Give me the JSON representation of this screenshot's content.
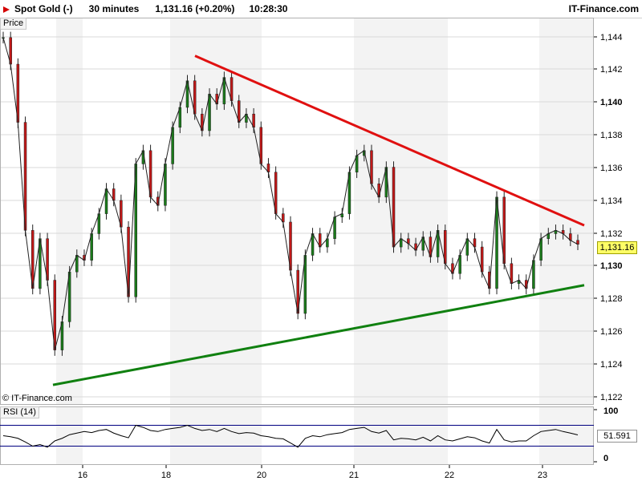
{
  "header": {
    "instrument": "Spot Gold (-)",
    "timeframe": "30 minutes",
    "quote": "1,131.16 (+0.20%)",
    "time": "10:28:30",
    "brand": "IT-Finance.com",
    "arrow_color": "#d40000"
  },
  "price_panel": {
    "tag": "Price",
    "copyright": "© IT-Finance.com",
    "last_price_label": "1,131.16"
  },
  "rsi_panel": {
    "tag": "RSI (14)",
    "value_label": "51.591",
    "upper_label": "100",
    "lower_label": "0"
  },
  "colors": {
    "resistance": "#e01010",
    "support": "#108010",
    "candle": "#222222",
    "up_body": "#1a7a1a",
    "down_body": "#c01818",
    "shade": "#f3f3f3"
  },
  "chart_data": [
    {
      "type": "line",
      "title": "Spot Gold (-) 30 minutes",
      "xlabel": "",
      "ylabel": "Price",
      "x_ticks": [
        "16",
        "18",
        "20",
        "21",
        "22",
        "23"
      ],
      "y_ticks": [
        "1,122",
        "1,124",
        "1,126",
        "1,128",
        "1,130",
        "1,132",
        "1,134",
        "1,136",
        "1,138",
        "1,140",
        "1,142",
        "1,144"
      ],
      "ylim": [
        1121.5,
        1144.8
      ],
      "x": [
        0,
        0.7,
        1.4,
        2.1,
        2.8,
        3.5,
        4.2,
        4.9,
        5.6,
        6.3,
        7.0,
        7.7,
        8.4,
        9.1,
        9.8,
        10.5,
        11.2,
        11.9,
        12.6,
        13.3,
        14.0,
        14.7,
        15.4,
        16.1,
        16.8,
        17.5,
        18.2,
        18.9,
        19.6,
        20.3,
        21.0,
        21.7,
        22.4,
        23.1,
        23.8,
        24.5,
        25.2,
        25.9,
        26.6,
        27.3,
        28.0,
        28.7,
        29.4,
        30.1,
        30.8,
        31.5,
        32.2,
        32.9,
        33.6,
        34.3,
        35.0,
        35.7,
        36.4,
        37.1,
        37.8,
        38.5,
        39.2,
        39.9,
        40.6,
        41.3,
        42.0,
        42.7,
        43.4,
        44.1,
        44.8,
        45.5,
        46.2,
        46.9,
        47.6,
        48.3,
        49.0,
        49.7,
        50.4,
        51.1,
        51.8,
        52.5,
        53.2,
        53.9,
        54.6,
        55.3,
        56.0,
        56.7,
        57.4,
        58.1,
        58.8,
        59.5,
        60.2,
        60.9,
        61.6,
        62.3,
        63.0
      ],
      "series": [
        {
          "values": [
            1143.6,
            1142.0,
            1138.5,
            1132.0,
            1128.5,
            1131.5,
            1129.0,
            1124.8,
            1126.5,
            1129.5,
            1130.5,
            1130.2,
            1131.8,
            1133.0,
            1134.5,
            1133.8,
            1132.2,
            1128.0,
            1136.0,
            1136.8,
            1134.0,
            1133.5,
            1136.0,
            1138.2,
            1139.4,
            1141.0,
            1139.0,
            1138.0,
            1140.2,
            1139.6,
            1141.2,
            1139.8,
            1138.5,
            1139.0,
            1138.2,
            1136.0,
            1135.5,
            1133.0,
            1132.5,
            1129.6,
            1127.0,
            1130.5,
            1131.8,
            1131.0,
            1131.5,
            1132.8,
            1133.0,
            1135.5,
            1136.5,
            1136.8,
            1134.8,
            1134.0,
            1135.8,
            1131.0,
            1131.5,
            1131.2,
            1130.8,
            1131.6,
            1130.4,
            1132.0,
            1130.0,
            1129.4,
            1130.5,
            1131.5,
            1131.0,
            1129.5,
            1128.5,
            1134.0,
            1130.0,
            1128.8,
            1129.0,
            1128.5,
            1130.2,
            1131.5,
            1131.8,
            1132.0,
            1131.8,
            1131.4,
            1131.16
          ]
        }
      ],
      "annotations": [
        "resistance trendline (red)",
        "support trendline (green)"
      ],
      "grid": true,
      "last_price": 1131.16
    },
    {
      "type": "line",
      "title": "RSI (14)",
      "y_ticks": [
        "0",
        "100"
      ],
      "ylim": [
        0,
        100
      ],
      "bands": [
        30,
        70
      ],
      "last_value": 51.591,
      "series": [
        {
          "name": "RSI (14)",
          "values": [
            50,
            48,
            45,
            38,
            30,
            33,
            28,
            40,
            45,
            52,
            55,
            58,
            56,
            60,
            62,
            55,
            50,
            46,
            70,
            66,
            60,
            58,
            62,
            64,
            66,
            70,
            64,
            60,
            62,
            58,
            64,
            58,
            54,
            56,
            55,
            50,
            48,
            45,
            44,
            36,
            28,
            45,
            50,
            48,
            52,
            54,
            56,
            62,
            64,
            66,
            58,
            55,
            60,
            42,
            45,
            44,
            42,
            47,
            40,
            50,
            42,
            40,
            44,
            48,
            46,
            40,
            36,
            62,
            42,
            38,
            40,
            40,
            50,
            58,
            60,
            62,
            58,
            55,
            51.591
          ]
        }
      ],
      "grid": false
    }
  ]
}
